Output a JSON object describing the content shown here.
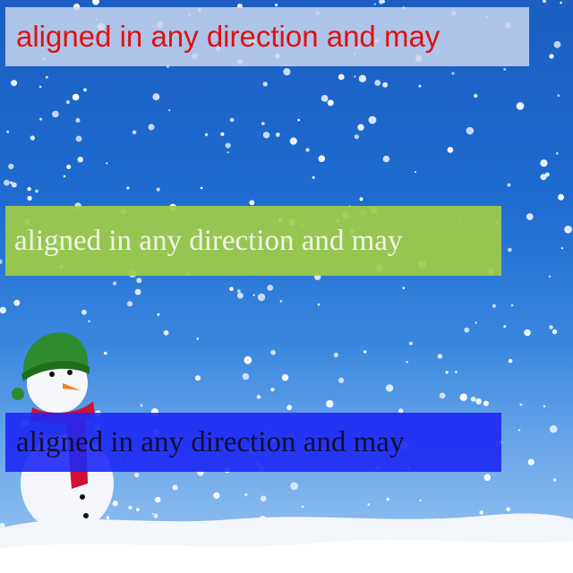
{
  "banners": [
    {
      "text": "aligned in any direction and may",
      "color": "#e01010"
    },
    {
      "text": "aligned in any direction and may",
      "color": "#f2f6e8"
    },
    {
      "text": "aligned in any direction and may",
      "color": "#101030"
    }
  ],
  "scene": {
    "sky_top": "#1c5ec2",
    "sky_bottom": "#9cc6f2",
    "snow_color": "#ffffff",
    "hat_color": "#2e8b2e",
    "scarf_color": "#d01030",
    "nose_color": "#f08020"
  }
}
